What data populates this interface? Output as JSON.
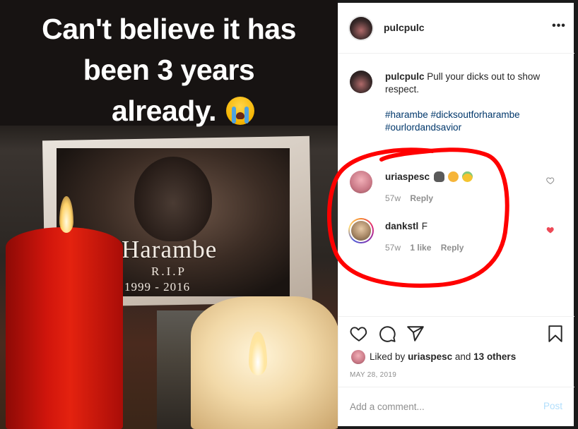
{
  "photo": {
    "caption_lines": [
      "Can't believe it has",
      "been 3 years",
      "already."
    ],
    "caption_emoji": "loudly-crying-face-emoji",
    "memorial_name": "Harambe",
    "memorial_rip": "R.I.P",
    "memorial_years": "1999 - 2016"
  },
  "post": {
    "header_username": "pulcpulc",
    "more_icon": "•••",
    "caption": {
      "username": "pulcpulc",
      "text": "Pull your dicks out to show respect.",
      "hashtags": "#harambe #dicksoutforharambe #ourlordandsavior"
    },
    "comments": [
      {
        "username": "uriaspesc",
        "text": "",
        "emojis": [
          "gorilla-emoji",
          "cat-face-emoji",
          "angel-face-emoji"
        ],
        "age": "57w",
        "likes": "",
        "reply_label": "Reply",
        "liked": false
      },
      {
        "username": "dankstl",
        "text": "F",
        "emojis": [],
        "age": "57w",
        "likes": "1 like",
        "reply_label": "Reply",
        "liked": true
      }
    ],
    "actions": {
      "like_icon": "heart-outline-icon",
      "comment_icon": "comment-bubble-icon",
      "share_icon": "paper-plane-icon",
      "save_icon": "bookmark-icon"
    },
    "liked_by": {
      "prefix": "Liked by",
      "username": "uriaspesc",
      "middle": "and",
      "others": "13 others"
    },
    "date": "MAY 28, 2019",
    "comment_placeholder": "Add a comment...",
    "post_label": "Post"
  },
  "colors": {
    "heart_liked": "#ed4956",
    "hashtag": "#00376b",
    "post_button_disabled": "#b2dffc",
    "annotation_red": "#ff0000"
  }
}
